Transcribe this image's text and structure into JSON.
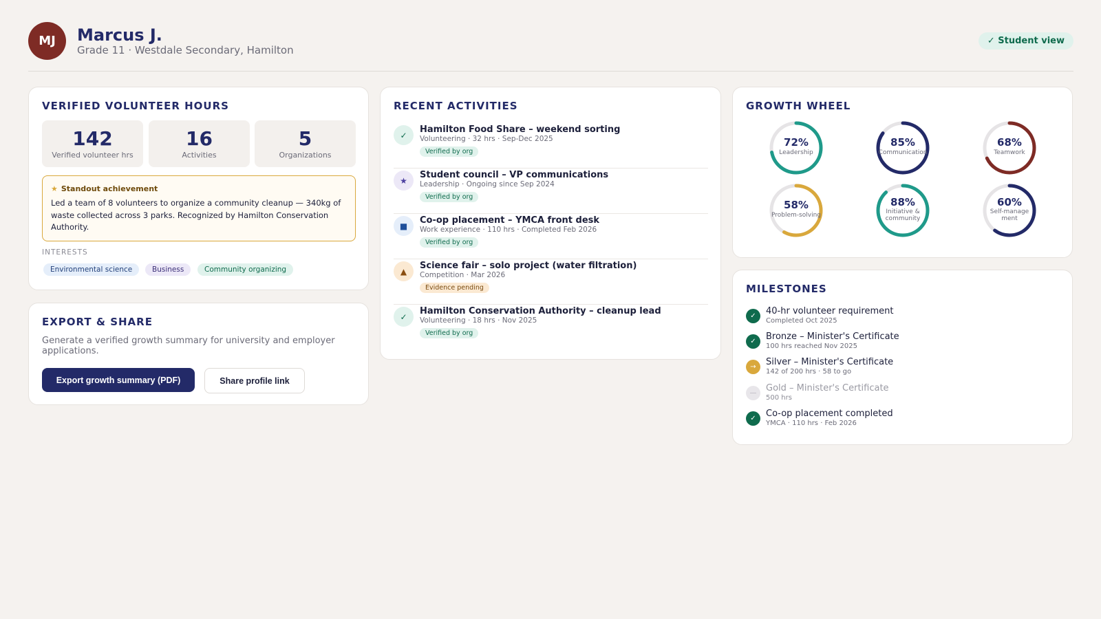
{
  "header": {
    "initials": "MJ",
    "name": "Marcus J.",
    "subtitle": "Grade 11 · Westdale Secondary, Hamilton",
    "view_badge": "✓ Student view"
  },
  "hours": {
    "title": "VERIFIED VOLUNTEER HOURS",
    "stats": [
      {
        "value": "142",
        "label": "Verified volunteer hrs"
      },
      {
        "value": "16",
        "label": "Activities"
      },
      {
        "value": "5",
        "label": "Organizations"
      }
    ],
    "standout": {
      "heading": "Standout achievement",
      "text": "Led a team of 8 volunteers to organize a community cleanup — 340kg of waste collected across 3 parks. Recognized by Hamilton Conservation Authority."
    },
    "interests_label": "INTERESTS",
    "interests": [
      "Environmental science",
      "Business",
      "Community organizing"
    ]
  },
  "export": {
    "title": "EXPORT & SHARE",
    "description": "Generate a verified growth summary for university and employer applications.",
    "primary_button": "Export growth summary (PDF)",
    "secondary_button": "Share profile link"
  },
  "activities": {
    "title": "RECENT ACTIVITIES",
    "items": [
      {
        "icon": "check-icon",
        "glyph": "✓",
        "title": "Hamilton Food Share – weekend sorting",
        "meta": "Volunteering · 32 hrs · Sep-Dec 2025",
        "badge": "Verified by org"
      },
      {
        "icon": "star-icon",
        "glyph": "★",
        "title": "Student council – VP communications",
        "meta": "Leadership · Ongoing since Sep 2024",
        "badge": "Verified by org"
      },
      {
        "icon": "square-icon",
        "glyph": "■",
        "title": "Co-op placement – YMCA front desk",
        "meta": "Work experience · 110 hrs · Completed Feb 2026",
        "badge": "Verified by org"
      },
      {
        "icon": "triangle-icon",
        "glyph": "▲",
        "title": "Science fair – solo project (water filtration)",
        "meta": "Competition · Mar 2026",
        "badge": "Evidence pending"
      },
      {
        "icon": "check-icon",
        "glyph": "✓",
        "title": "Hamilton Conservation Authority – cleanup lead",
        "meta": "Volunteering · 18 hrs · Nov 2025",
        "badge": "Verified by org"
      }
    ]
  },
  "wheel": {
    "title": "GROWTH WHEEL",
    "rings": [
      {
        "pct": "72%",
        "value": 0.72,
        "label": "Leadership",
        "color": "#1f9a8a"
      },
      {
        "pct": "85%",
        "value": 0.85,
        "label": "Communication",
        "color": "#232a68"
      },
      {
        "pct": "68%",
        "value": 0.68,
        "label": "Teamwork",
        "color": "#7e2b25"
      },
      {
        "pct": "58%",
        "value": 0.58,
        "label": "Problem-solving",
        "color": "#d9a83c"
      },
      {
        "pct": "88%",
        "value": 0.88,
        "label": "Initiative & community",
        "color": "#1f9a8a"
      },
      {
        "pct": "60%",
        "value": 0.6,
        "label": "Self-management",
        "color": "#232a68"
      }
    ]
  },
  "milestones": {
    "title": "MILESTONES",
    "items": [
      {
        "status": "done",
        "glyph": "✓",
        "title": "40-hr volunteer requirement",
        "sub": "Completed Oct 2025"
      },
      {
        "status": "done",
        "glyph": "✓",
        "title": "Bronze – Minister's Certificate",
        "sub": "100 hrs reached Nov 2025"
      },
      {
        "status": "progress",
        "glyph": "→",
        "title": "Silver – Minister's Certificate",
        "sub": "142 of 200 hrs · 58 to go"
      },
      {
        "status": "locked",
        "glyph": "—",
        "title": "Gold – Minister's Certificate",
        "sub": "500 hrs"
      },
      {
        "status": "done",
        "glyph": "✓",
        "title": "Co-op placement completed",
        "sub": "YMCA · 110 hrs · Feb 2026"
      }
    ]
  },
  "colors": {
    "navy": "#232a68",
    "teal": "#1f9a8a",
    "brick": "#7e2b25",
    "gold": "#d9a83c",
    "success": "#0f6b4d"
  }
}
